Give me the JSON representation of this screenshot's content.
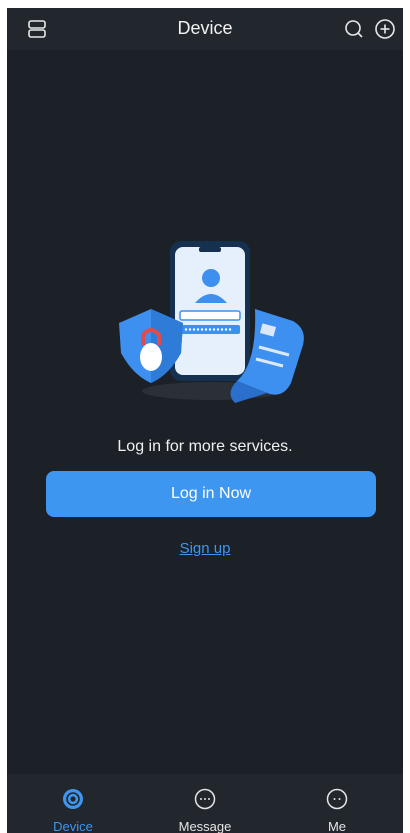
{
  "header": {
    "title": "Device",
    "left_icon": "menu-icon",
    "right_icons": [
      "search-icon",
      "add-icon"
    ]
  },
  "main": {
    "illustration": "login-illustration",
    "prompt": "Log in for more services.",
    "login_button": "Log in Now",
    "signup_link": "Sign up"
  },
  "tabbar": {
    "tabs": [
      {
        "label": "Device",
        "icon": "device-icon",
        "active": true
      },
      {
        "label": "Message",
        "icon": "message-icon",
        "active": false
      },
      {
        "label": "Me",
        "icon": "me-icon",
        "active": false
      }
    ]
  },
  "colors": {
    "background": "#1c2027",
    "bar": "#22262d",
    "accent": "#3d96ef",
    "text": "#f0f0f0"
  }
}
